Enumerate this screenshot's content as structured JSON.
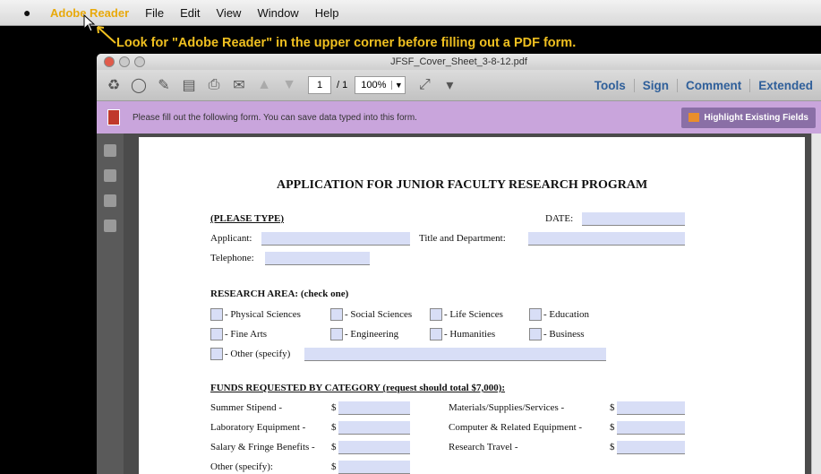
{
  "menubar": {
    "apple": "",
    "app_name": "Adobe Reader",
    "items": [
      "File",
      "Edit",
      "View",
      "Window",
      "Help"
    ]
  },
  "annotation": "Look for \"Adobe Reader\" in the upper corner before filling out a PDF form.",
  "window": {
    "title": "JFSF_Cover_Sheet_3-8-12.pdf",
    "page_current": "1",
    "page_total": "/ 1",
    "zoom": "100%",
    "tool_buttons": [
      "Tools",
      "Sign",
      "Comment",
      "Extended"
    ]
  },
  "formbar": {
    "message": "Please fill out the following form. You can save data typed into this form.",
    "highlight_button": "Highlight Existing Fields"
  },
  "form": {
    "title": "APPLICATION FOR JUNIOR FACULTY RESEARCH PROGRAM",
    "please_type": "(PLEASE TYPE)",
    "date_label": "DATE:",
    "applicant_label": "Applicant:",
    "title_dept_label": "Title and Department:",
    "telephone_label": "Telephone:",
    "research_area_heading": "RESEARCH AREA: (check one)",
    "research_areas": [
      "- Physical Sciences",
      "- Social Sciences",
      "- Life Sciences",
      "- Education",
      "- Fine Arts",
      "- Engineering",
      "- Humanities",
      "- Business",
      "- Other (specify)"
    ],
    "funds_heading": "FUNDS REQUESTED BY CATEGORY (request should total $7,000):",
    "funds_left": [
      "Summer Stipend -",
      "Laboratory Equipment -",
      "Salary & Fringe Benefits -",
      "Other (specify):"
    ],
    "funds_right": [
      "Materials/Supplies/Services -",
      "Computer & Related Equipment -",
      "Research Travel -"
    ],
    "dollar": "$"
  },
  "colors": {
    "accent": "#e8a90b",
    "form_bar": "#c9a5dc",
    "field_fill": "#d8def6",
    "link_blue": "#2f5f9a"
  }
}
